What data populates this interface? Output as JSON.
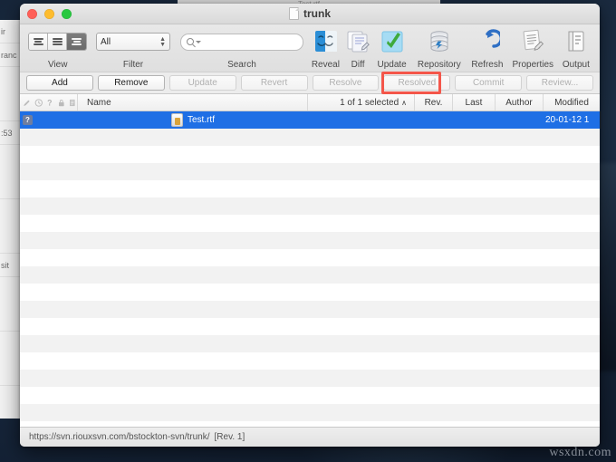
{
  "desktop": {
    "watermark": "wsxdn.com"
  },
  "background_windows": {
    "top_fragment": "Test.rtf",
    "left_fragments": [
      "ir",
      "ranc",
      "",
      ":53",
      "",
      "",
      "sit",
      "",
      ""
    ]
  },
  "window": {
    "title": "trunk",
    "title_icon": "document-icon",
    "traffic_lights": [
      {
        "name": "close",
        "color": "#ff5f57"
      },
      {
        "name": "minimize",
        "color": "#febc2e"
      },
      {
        "name": "zoom",
        "color": "#28c840"
      }
    ]
  },
  "toolbar": {
    "groups": [
      {
        "label": "View",
        "icon": "view-segmented-icon"
      },
      {
        "label": "Filter",
        "icon": "filter-popup-icon"
      },
      {
        "label": "Search",
        "icon": "search-icon"
      },
      {
        "label": "Reveal",
        "icon": "reveal-finder-icon"
      },
      {
        "label": "Diff",
        "icon": "diff-compare-icon"
      },
      {
        "label": "Update",
        "icon": "update-checkmark-icon"
      },
      {
        "label": "Repository",
        "icon": "repository-database-icon"
      },
      {
        "label": "Refresh",
        "icon": "refresh-arrow-icon"
      },
      {
        "label": "Properties",
        "icon": "properties-list-icon"
      },
      {
        "label": "Output",
        "icon": "output-console-icon"
      }
    ],
    "filter_value": "All",
    "search_value": "",
    "search_placeholder": ""
  },
  "buttons": [
    {
      "label": "Add",
      "disabled": false,
      "highlighted": false
    },
    {
      "label": "Remove",
      "disabled": false,
      "highlighted": false
    },
    {
      "label": "Update",
      "disabled": true,
      "highlighted": false
    },
    {
      "label": "Revert",
      "disabled": true,
      "highlighted": false
    },
    {
      "label": "Resolve",
      "disabled": true,
      "highlighted": false
    },
    {
      "label": "Resolved",
      "disabled": true,
      "highlighted": false
    },
    {
      "label": "Commit",
      "disabled": true,
      "highlighted": true
    },
    {
      "label": "Review...",
      "disabled": true,
      "highlighted": false
    }
  ],
  "highlight_color": "#f4564a",
  "accent_color": "#1f6fe5",
  "list": {
    "flag_icons": [
      "pencil-icon",
      "clock-icon",
      "question-mark-icon",
      "lock-icon",
      "document-icon"
    ],
    "columns": [
      {
        "key": "name",
        "label": "Name"
      },
      {
        "key": "selection",
        "label": "1 of 1 selected",
        "sort_caret": "∧"
      },
      {
        "key": "rev",
        "label": "Rev."
      },
      {
        "key": "last",
        "label": "Last"
      },
      {
        "key": "author",
        "label": "Author"
      },
      {
        "key": "modified",
        "label": "Modified"
      }
    ],
    "rows": [
      {
        "status": "?",
        "icon": "rtf-file-icon",
        "name": "Test.rtf",
        "rev": "",
        "last": "",
        "author": "",
        "modified": "20-01-12 1",
        "selected": true
      }
    ],
    "empty_row_count": 17
  },
  "statusbar": {
    "url": "https://svn.riouxsvn.com/bstockton-svn/trunk/",
    "revision": "[Rev. 1]"
  }
}
